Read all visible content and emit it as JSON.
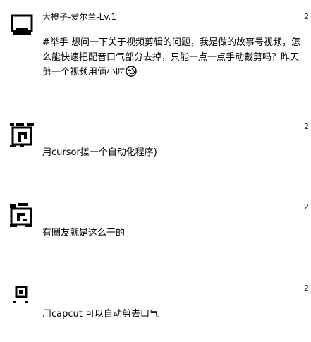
{
  "comments": [
    {
      "author": "大橙子-爱尔兰-Lv.1",
      "timestamp": "2",
      "text": "#举手 想问一下关于视频剪辑的问题，我是做的故事号视频，怎么能快速把配音口气部分去掉，只能一点一点手动裁剪吗？昨天剪一个视频用俩小时",
      "emoji": "facepalm-emoji"
    },
    {
      "author": "",
      "timestamp": "2",
      "text": "用cursor搓一个自动化程序)"
    },
    {
      "author": "",
      "timestamp": "2",
      "text": "有圈友就是这么干的"
    },
    {
      "author": "",
      "timestamp": "2",
      "text": "用capcut 可以自动剪去口气"
    }
  ]
}
